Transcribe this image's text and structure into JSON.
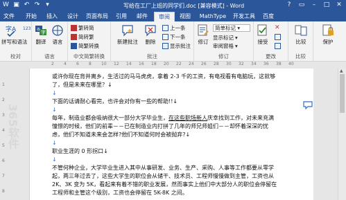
{
  "titlebar": {
    "title": "写给在工厂上班的同学们.doc [兼容模式] - Word",
    "qat_icons": [
      "word-icon",
      "save-icon",
      "undo-icon",
      "redo-icon",
      "customize-icon"
    ],
    "help": "?",
    "restore": "▭",
    "minimize": "–",
    "maximize": "□",
    "close": "✕"
  },
  "tabs": [
    "文件",
    "开始",
    "插入",
    "设计",
    "页面布局",
    "引用",
    "邮件",
    "审阅",
    "视图",
    "MathType",
    "开发工具",
    "百度"
  ],
  "active_tab": "审阅",
  "ribbon": {
    "proofing": {
      "label": "校对",
      "spell": "拼写和语法",
      "abc_icon": "字A",
      "count_icon": "123"
    },
    "language": {
      "label": "语言",
      "translate": "翻译",
      "language": "语言"
    },
    "chinese": {
      "label": "中文简繁转换",
      "to_trad": "繁转简",
      "to_simp": "简转繁",
      "convert": "简繁转换"
    },
    "comments": {
      "label": "批注",
      "new": "新建批注",
      "delete": "删除",
      "prev": "上一条",
      "next": "下一条",
      "show": "显示批注"
    },
    "tracking": {
      "label": "修订",
      "track": "修订",
      "markup": "简单标记",
      "show_markup": "显示标记",
      "pane": "审阅窗格"
    },
    "changes": {
      "label": "更改",
      "accept": "接受"
    },
    "compare": {
      "label": "比较",
      "compare": "比较"
    },
    "protect": {
      "label": "",
      "protect": "保护"
    }
  },
  "ruler_marks": [
    "2",
    "4",
    "6",
    "8",
    "10",
    "12",
    "14",
    "16",
    "18",
    "20",
    "22",
    "24",
    "26",
    "28",
    "30",
    "32",
    "34",
    "36",
    "38",
    "40",
    "42",
    "44",
    "46",
    "48"
  ],
  "vruler_marks": [
    "1",
    "2",
    "3",
    "4",
    "5",
    "6",
    "7",
    "8"
  ],
  "doc": {
    "l1": "或许你现在背井离乡，生活过的马马虎虎，拿着 2-3 千的工资，有电视看有电脑玩，这就够",
    "l2": "了，但是未来在哪里？↓",
    "l3": "↓",
    "l4": "下面的话请耐心看完，也许会对你有一些的帮助!!↓",
    "l5": "↓",
    "l6a": "每年，制造业都会吸纳很大一部分大学毕业生，",
    "l6b": "在这些职场新人",
    "l6c": "庆幸找到工作，对未来充满",
    "l7": "憧憬的时候，他们的前辈－－已在制造业内打拼了几年的师兄师姐们－－却怀着深深的忧",
    "l8": "虑，他们不知道未来会怎样?他们不知道何时会被抛弃?↓",
    "l9": "↓",
    "l10": "职业生涯的 0 形拐口↓",
    "l11": "↓",
    "l12": "不管何种企业，大学毕业生进入其中从事研发、业务、生产、采购、人事等工作都要从零学",
    "l13": "起，两三年过去了，这些大学生的职位会从储干、技术员、工程师慢慢做到主管，工资也从",
    "l14": "2K、3K 变为 5K，看起来有着不错的职业发展，然而事实上他们中大部分人的职位会停留在",
    "l15": "工程师和主管这个级别，工资也会停留在 5K-8K 之间。"
  },
  "watermark": "365软件"
}
